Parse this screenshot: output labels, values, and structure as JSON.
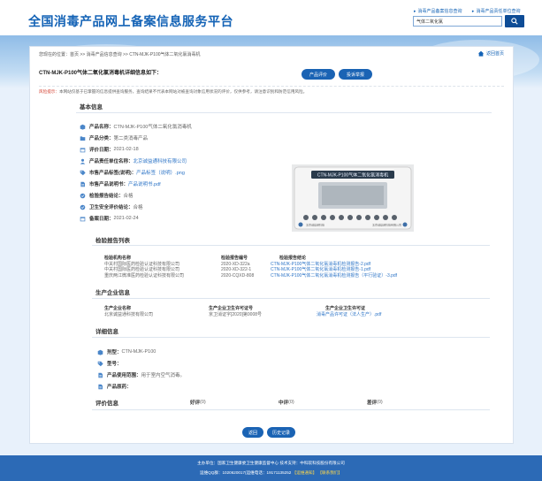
{
  "header": {
    "site_title": "全国消毒产品网上备案信息服务平台",
    "top_links": [
      "消毒产品备案信息查询",
      "消毒产品责任单位查询"
    ],
    "search": {
      "value": "气体二氧化氯",
      "button_icon": "search-icon"
    }
  },
  "breadcrumb": "您现在的位置：首页 >> 消毒产品信息查询 >> CTN-MJK-P100气体二氧化氯消毒机",
  "back_link": "返回首页",
  "page_title": "CTN-MJK-P100气体二氧化氯消毒机详细信息如下：",
  "buttons": {
    "evaluate": "产品评价",
    "report": "投诉举报",
    "back": "返回",
    "history": "历史记录"
  },
  "notice": {
    "label": "风险提示：",
    "text": "本网站仅基于已掌握的信息提供查询服务，查询结果不代表本网站对被查询对象信用状况的评价，仅供参考，请注意识别和防范信用风险。"
  },
  "basic_info": {
    "title": "基本信息",
    "fields": [
      {
        "key": "产品名称：",
        "value": "CTN-MJK-P100气体二氧化氯消毒机",
        "icon": "box-icon",
        "link": false
      },
      {
        "key": "产品分类：",
        "value": "第二类消毒产品",
        "icon": "folder-icon",
        "link": false
      },
      {
        "key": "评价日期：",
        "value": "2021-02-18",
        "icon": "calendar-icon",
        "link": false
      },
      {
        "key": "产品责任单位名称：",
        "value": "北京诚益通科技有限公司",
        "icon": "user-icon",
        "link": true
      },
      {
        "key": "市售产品标签(说明)：",
        "value": "产品标签（说明）.png",
        "icon": "tag-icon",
        "link": true
      },
      {
        "key": "市售产品说明书：",
        "value": "产品说明书.pdf",
        "icon": "document-icon",
        "link": true
      },
      {
        "key": "检验报告结论：",
        "value": "合格",
        "icon": "check-icon",
        "link": false
      },
      {
        "key": "卫生安全评价结论：",
        "value": "合格",
        "icon": "check-icon",
        "link": false
      },
      {
        "key": "备案日期：",
        "value": "2021-02-24",
        "icon": "calendar-icon",
        "link": false
      }
    ],
    "product_image": {
      "panel_title": "CTN-MJK-P100气体二氧化氯消毒机",
      "left_caption": "北京诚益通科技",
      "right_caption": "北京诚益通科技有限公司"
    }
  },
  "reports": {
    "title": "检验报告列表",
    "headers": [
      "检验机构名称",
      "检验报告编号",
      "检验报告结论"
    ],
    "rows": [
      [
        "中关村国际医药检验认证科技有限公司",
        "2020-XD-322a",
        "CTN-MJK-P100气体二氧化氯消毒机检测报告-2.pdf"
      ],
      [
        "中关村国际医药检验认证科技有限公司",
        "2020-XD-322-1",
        "CTN-MJK-P100气体二氧化氯消毒机检测报告-1.pdf"
      ],
      [
        "重庆两江微准医药检验认证科技有限公司",
        "2020-CQXD-808",
        "CTN-MJK-P100气体二氧化氯消毒机检测报告（平行验证）-3.pdf"
      ]
    ]
  },
  "enterprise": {
    "title": "生产企业信息",
    "headers": [
      "生产企业名称",
      "生产企业卫生许可证号",
      "生产企业卫生许可证"
    ],
    "row": [
      "北京诚益通科技有限公司",
      "京卫消证字[2020]第0008号",
      "消毒产品许可证（法人生产）.pdf"
    ]
  },
  "details": {
    "title": "详细信息",
    "fields": [
      {
        "key": "剂型：",
        "value": "CTN-MJK-P100",
        "icon": "box-icon"
      },
      {
        "key": "型号：",
        "value": "",
        "icon": "tag-icon"
      },
      {
        "key": "产品使用范围：",
        "value": "用于室内空气消毒。",
        "icon": "document-icon"
      },
      {
        "key": "产品原药：",
        "value": "",
        "icon": "document-icon"
      }
    ]
  },
  "evaluation": {
    "title": "评价信息",
    "items": [
      {
        "label": "好评",
        "count": "(0)"
      },
      {
        "label": "中评",
        "count": "(0)"
      },
      {
        "label": "差评",
        "count": "(0)"
      }
    ]
  },
  "footer": {
    "line1": "主办单位：国家卫生健康委卫生健康监督中心 技术支持：中科软科技股份有限公司",
    "line2_prefix": "运维QQ群：1020620017(运维电话：19171135252",
    "line2_link1": "【运维通知】",
    "line2_link2": "【联系我们】"
  },
  "colors": {
    "brand": "#1463b6",
    "accent": "#1a63b4",
    "warning": "#d23a2a",
    "footer": "#2c6ab6"
  }
}
